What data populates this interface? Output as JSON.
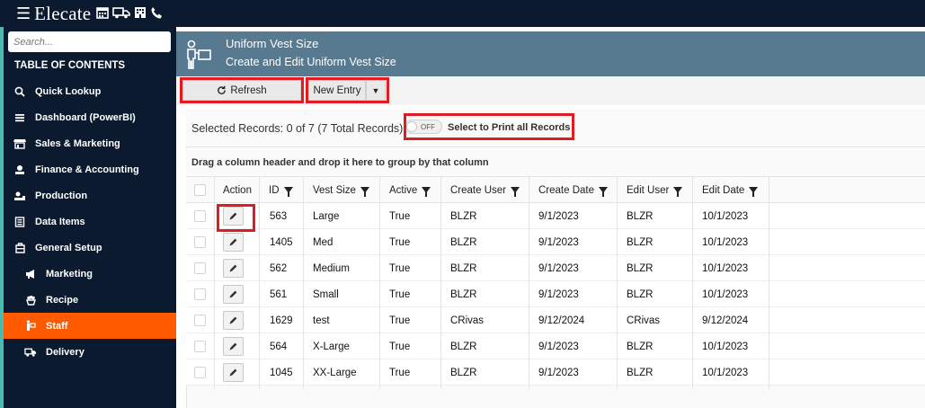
{
  "app": {
    "logo": "Elecate",
    "top_icons": [
      "calendar-icon",
      "truck-icon",
      "building-icon",
      "phone-icon"
    ]
  },
  "sidebar": {
    "search_placeholder": "Search...",
    "toc_title": "TABLE OF CONTENTS",
    "items": [
      {
        "label": "Quick Lookup",
        "icon": "search-icon",
        "sub": false,
        "active": false
      },
      {
        "label": "Dashboard (PowerBI)",
        "icon": "bars-icon",
        "sub": false,
        "active": false
      },
      {
        "label": "Sales & Marketing",
        "icon": "store-icon",
        "sub": false,
        "active": false
      },
      {
        "label": "Finance & Accounting",
        "icon": "finance-icon",
        "sub": false,
        "active": false
      },
      {
        "label": "Production",
        "icon": "production-icon",
        "sub": false,
        "active": false
      },
      {
        "label": "Data Items",
        "icon": "data-icon",
        "sub": false,
        "active": false
      },
      {
        "label": "General Setup",
        "icon": "setup-icon",
        "sub": false,
        "active": false
      },
      {
        "label": "Marketing",
        "icon": "megaphone-icon",
        "sub": true,
        "active": false
      },
      {
        "label": "Recipe",
        "icon": "recipe-icon",
        "sub": true,
        "active": false
      },
      {
        "label": "Staff",
        "icon": "staff-icon",
        "sub": true,
        "active": true
      },
      {
        "label": "Delivery",
        "icon": "truck-icon",
        "sub": true,
        "active": false
      }
    ]
  },
  "header": {
    "title": "Uniform Vest Size",
    "subtitle": "Create and Edit Uniform Vest Size"
  },
  "toolbar": {
    "refresh_label": "Refresh",
    "new_entry_label": "New Entry"
  },
  "selection": {
    "text": "Selected Records: 0 of 7 (7 Total Records)",
    "toggle_state": "OFF",
    "print_label": "Select to Print all Records"
  },
  "group_hint": "Drag a column header and drop it here to group by that column",
  "grid": {
    "columns": [
      "Action",
      "ID",
      "Vest Size",
      "Active",
      "Create User",
      "Create Date",
      "Edit User",
      "Edit Date"
    ],
    "rows": [
      [
        "563",
        "Large",
        "True",
        "BLZR",
        "9/1/2023",
        "BLZR",
        "10/1/2023"
      ],
      [
        "1405",
        "Med",
        "True",
        "BLZR",
        "9/1/2023",
        "BLZR",
        "10/1/2023"
      ],
      [
        "562",
        "Medium",
        "True",
        "BLZR",
        "9/1/2023",
        "BLZR",
        "10/1/2023"
      ],
      [
        "561",
        "Small",
        "True",
        "BLZR",
        "9/1/2023",
        "BLZR",
        "10/1/2023"
      ],
      [
        "1629",
        "test",
        "True",
        "CRivas",
        "9/12/2024",
        "CRivas",
        "9/12/2024"
      ],
      [
        "564",
        "X-Large",
        "True",
        "BLZR",
        "9/1/2023",
        "BLZR",
        "10/1/2023"
      ],
      [
        "1045",
        "XX-Large",
        "True",
        "BLZR",
        "9/1/2023",
        "BLZR",
        "10/1/2023"
      ]
    ]
  },
  "colors": {
    "nav_bg": "#0b1a2e",
    "accent": "#ff5a00",
    "header_bg": "#577a91",
    "highlight": "#e01b22"
  }
}
